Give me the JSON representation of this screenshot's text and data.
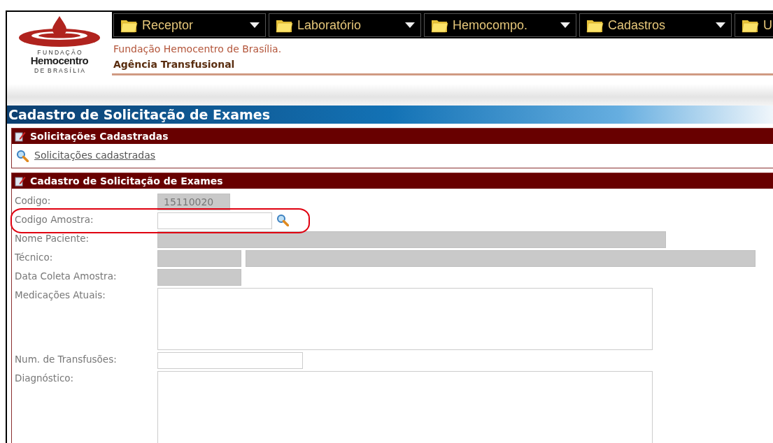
{
  "logo": {
    "line_1": "F U N D A Ç Ã O",
    "line_2": "Hemocentro",
    "line_3": "D E  B R A S Í L I A"
  },
  "menu": [
    {
      "label": "Receptor",
      "caret": true
    },
    {
      "label": "Laboratório",
      "caret": true
    },
    {
      "label": "Hemocompo.",
      "caret": true
    },
    {
      "label": "Cadastros",
      "caret": true
    },
    {
      "label": "U",
      "caret": false
    }
  ],
  "header": {
    "organization": "Fundação Hemocentro de Brasília.",
    "unit": "Agência Transfusional"
  },
  "page_title": "Cadastro de Solicitação de Exames",
  "sections": [
    {
      "title": "Solicitações Cadastradas",
      "link": "Solicitações cadastradas"
    },
    {
      "title": "Cadastro de Solicitação de Exames",
      "fields": [
        {
          "label": "Codigo:",
          "kind": "code",
          "disabled": true,
          "value": "15110020"
        },
        {
          "label": "Codigo Amostra:",
          "kind": "lookup",
          "disabled": false,
          "search": true,
          "highlighted": true
        },
        {
          "label": "Nome Paciente:",
          "kind": "wide",
          "disabled": true
        },
        {
          "label": "Técnico:",
          "kind": "pair",
          "disabled": true
        },
        {
          "label": "Data Coleta Amostra:",
          "kind": "date",
          "disabled": true
        },
        {
          "label": "Medicações Atuais:",
          "kind": "textarea",
          "disabled": false
        },
        {
          "label": "Num. de Transfusões:",
          "kind": "number",
          "disabled": false
        },
        {
          "label": "Diagnóstico:",
          "kind": "textarea",
          "disabled": false,
          "cut": true
        }
      ]
    }
  ]
}
